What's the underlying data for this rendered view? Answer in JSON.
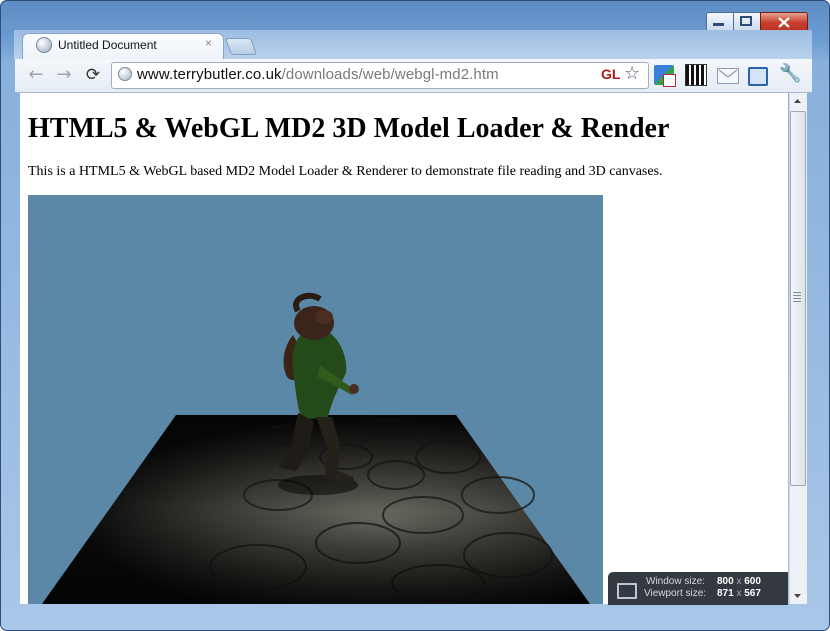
{
  "browser": {
    "tab_title": "Untitled Document",
    "tab_close": "×",
    "url_host": "www.terrybutler.co.uk",
    "url_path": "/downloads/web/webgl-md2.htm",
    "back_icon": "←",
    "forward_icon": "→",
    "reload_icon": "⟳",
    "star_icon": "☆",
    "gl_badge": "GL",
    "wrench_icon": "🔧"
  },
  "page": {
    "heading": "HTML5 & WebGL MD2 3D Model Loader & Render",
    "description": "This is a HTML5 & WebGL based MD2 Model Loader & Renderer to demonstrate file reading and 3D canvases."
  },
  "canvas": {
    "sky_color": "#5b88a7"
  },
  "size_overlay": {
    "window_label": "Window size:",
    "window_w": "800",
    "window_h": "600",
    "viewport_label": "Viewport size:",
    "viewport_w": "871",
    "viewport_h": "567",
    "sep": "x"
  }
}
